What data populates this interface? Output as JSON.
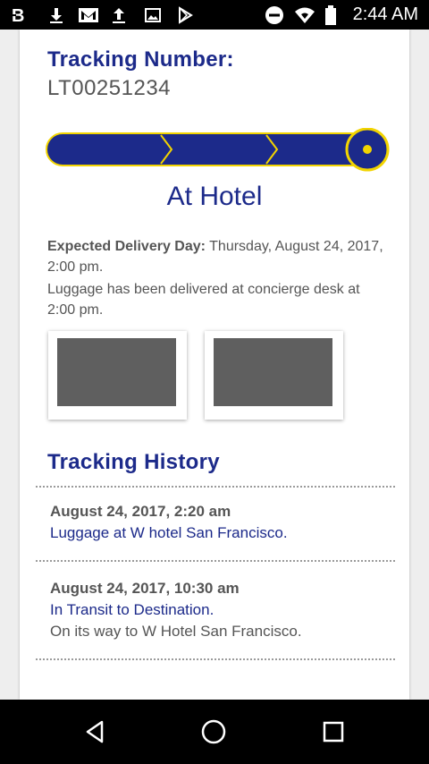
{
  "status_bar": {
    "time": "2:44 AM",
    "notification_icons": [
      "b-app-icon",
      "download-icon",
      "gmail-icon",
      "upload-icon",
      "image-icon",
      "play-store-icon"
    ],
    "system_icons": [
      "do-not-disturb-icon",
      "wifi-icon",
      "battery-icon"
    ]
  },
  "tracking": {
    "label": "Tracking Number:",
    "number": "LT00251234"
  },
  "progress": {
    "steps": 4,
    "current_step": 4,
    "accent_color": "#f2d400",
    "bar_color": "#1c2a8a"
  },
  "status": {
    "title": "At Hotel"
  },
  "delivery": {
    "label": "Expected Delivery Day:",
    "value": " Thursday, August 24, 2017, 2:00 pm.",
    "note": "Luggage has been delivered at concierge desk at 2:00 pm."
  },
  "history": {
    "title": "Tracking History",
    "entries": [
      {
        "date": "August 24, 2017, 2:20 am",
        "status": "Luggage at W hotel San Francisco.",
        "note": ""
      },
      {
        "date": "August 24, 2017, 10:30 am",
        "status": "In Transit to Destination.",
        "note": "On its way to W Hotel San Francisco."
      }
    ]
  },
  "nav": {
    "buttons": [
      "back-icon",
      "home-icon",
      "recents-icon"
    ]
  }
}
